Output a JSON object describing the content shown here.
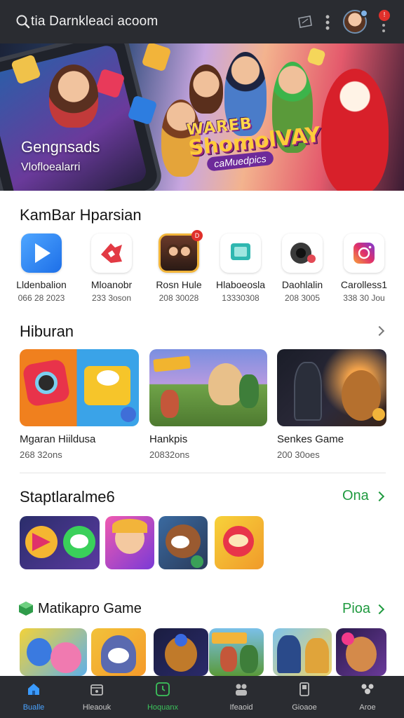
{
  "header": {
    "title": "tia Darnkleaci acoom",
    "icons": [
      "search-icon",
      "ticket-icon",
      "more-vert-icon",
      "avatar",
      "notification-icon"
    ],
    "notification_badge": "!"
  },
  "hero": {
    "title": "Gengnsads",
    "subtitle": "Vlofloealarri",
    "logo_line1": "WAREB",
    "logo_line2": "ShomolVAY",
    "logo_line3": "caMuedpics"
  },
  "section_apps": {
    "title": "KamBar Hparsian",
    "items": [
      {
        "name": "Lldenbalion",
        "size": "066 28 2023",
        "icon": "play-store-icon",
        "color": "#3b8ff2"
      },
      {
        "name": "Mloanobr",
        "size": "233 3oson",
        "icon": "puzzle-icon",
        "color": "#e23a44"
      },
      {
        "name": "Rosn Hule",
        "size": "208 30028",
        "icon": "family-game-icon",
        "color": "#e0b23c"
      },
      {
        "name": "Hlaboeosla",
        "size": "13330308",
        "icon": "chat-icon",
        "color": "#2fb7b0"
      },
      {
        "name": "Daohlalin",
        "size": "208 3005",
        "icon": "camera-icon",
        "color": "#333333"
      },
      {
        "name": "Carolless1",
        "size": "338 30 Jou",
        "icon": "instagram-icon",
        "color": "#d9417c"
      }
    ]
  },
  "section_hiburan": {
    "title": "Hiburan",
    "cards": [
      {
        "name": "Mgaran Hiildusa",
        "size": "268 32ons"
      },
      {
        "name": "Hankpis",
        "size": "20832ons"
      },
      {
        "name": "Senkes Game",
        "size": "200 30oes"
      }
    ]
  },
  "section_staptara": {
    "title": "Staptlaralme6",
    "action": "Ona"
  },
  "section_matika": {
    "title": "Matikapro Game",
    "action": "Pioa"
  },
  "bottom_nav": [
    {
      "label": "Bualle",
      "icon": "home-icon",
      "state": "active"
    },
    {
      "label": "Hleaouk",
      "icon": "calendar-icon",
      "state": "normal"
    },
    {
      "label": "Hoquanx",
      "icon": "clock-icon",
      "state": "green"
    },
    {
      "label": "Ifeaoid",
      "icon": "people-icon",
      "state": "normal"
    },
    {
      "label": "Gioaoe",
      "icon": "phone-icon",
      "state": "normal"
    },
    {
      "label": "Aroe",
      "icon": "group-icon",
      "state": "normal"
    }
  ]
}
